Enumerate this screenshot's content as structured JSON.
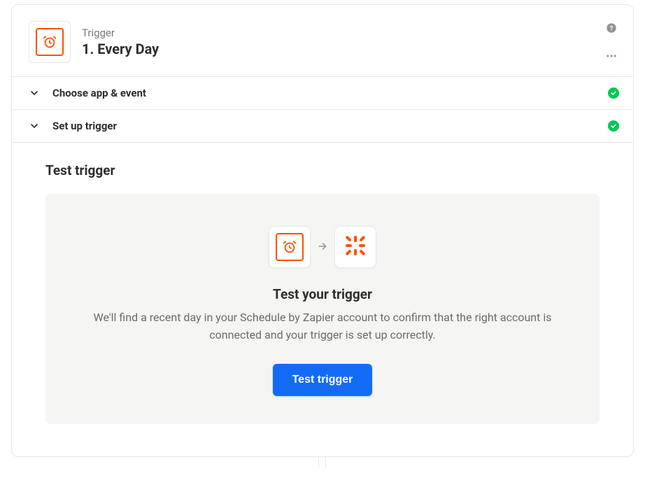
{
  "colors": {
    "accent_orange": "#ff4f00",
    "primary_blue": "#136bf5",
    "check_green": "#00c853"
  },
  "header": {
    "kicker": "Trigger",
    "title": "1. Every Day",
    "app_icon": "clock-icon"
  },
  "steps": [
    {
      "label": "Choose app & event",
      "completed": true
    },
    {
      "label": "Set up trigger",
      "completed": true
    }
  ],
  "test_section": {
    "title": "Test trigger",
    "left_tile_icon": "clock-icon",
    "right_tile_icon": "zapier-icon",
    "heading": "Test your trigger",
    "description": "We'll find a recent day in your Schedule by Zapier account to confirm that the right account is connected and your trigger is set up correctly.",
    "button_label": "Test trigger"
  }
}
